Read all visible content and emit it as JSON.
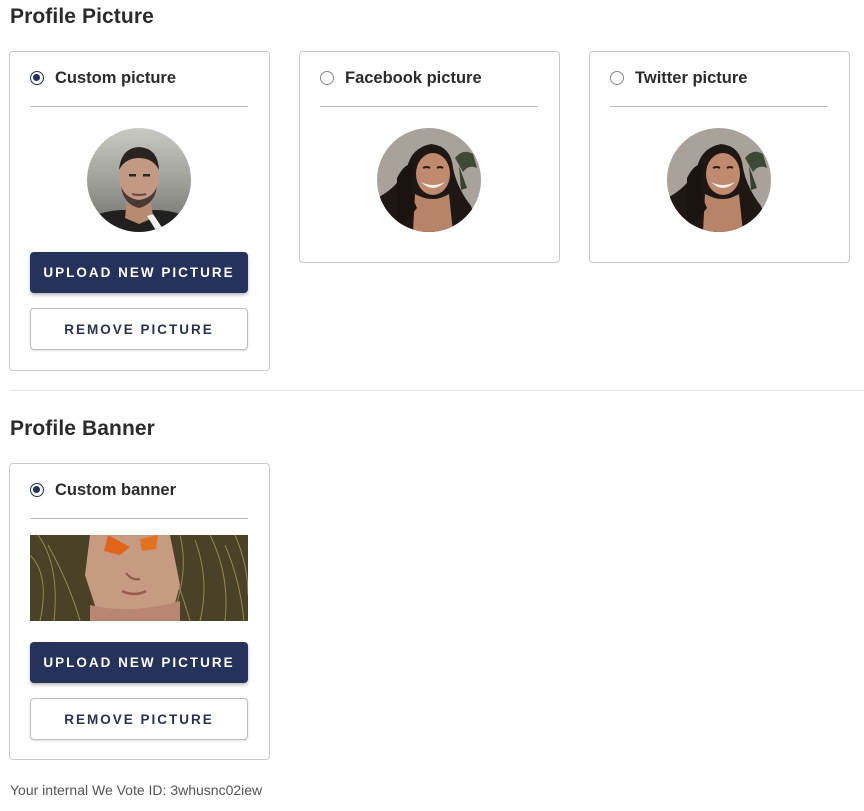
{
  "profile_picture": {
    "title": "Profile Picture",
    "options": [
      {
        "label": "Custom picture",
        "selected": true
      },
      {
        "label": "Facebook picture",
        "selected": false
      },
      {
        "label": "Twitter picture",
        "selected": false
      }
    ],
    "upload_label": "UPLOAD NEW PICTURE",
    "remove_label": "REMOVE PICTURE"
  },
  "profile_banner": {
    "title": "Profile Banner",
    "option": {
      "label": "Custom banner",
      "selected": true
    },
    "upload_label": "UPLOAD NEW PICTURE",
    "remove_label": "REMOVE PICTURE"
  },
  "footer": {
    "we_vote_id_text": "Your internal We Vote ID: 3whusnc02iew"
  },
  "colors": {
    "primary_button": "#25325c",
    "radio_selected": "#23305a",
    "card_border": "#c9c9c9"
  }
}
